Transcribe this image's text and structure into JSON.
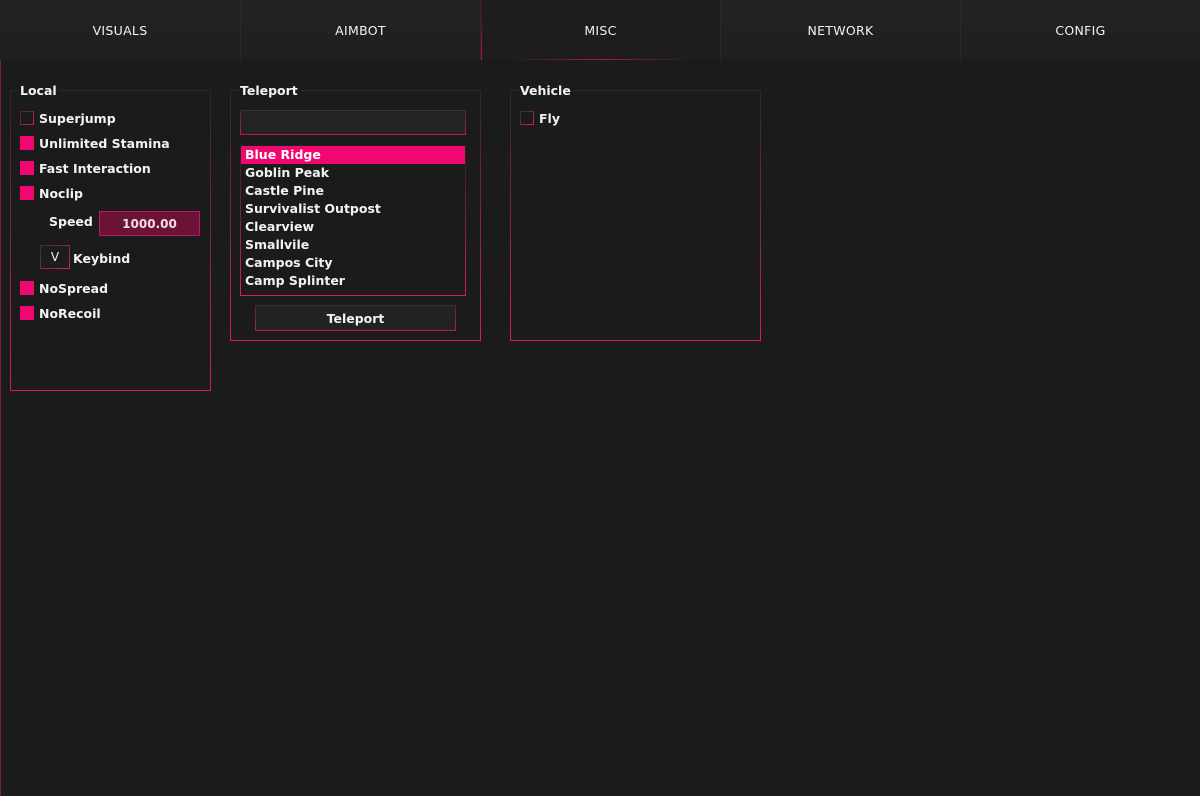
{
  "tabs": [
    {
      "label": "VISUALS",
      "active": false
    },
    {
      "label": "AIMBOT",
      "active": false
    },
    {
      "label": "MISC",
      "active": true
    },
    {
      "label": "NETWORK",
      "active": false
    },
    {
      "label": "CONFIG",
      "active": false
    }
  ],
  "local": {
    "title": "Local",
    "superjump": {
      "label": "Superjump",
      "checked": false
    },
    "unlimited_stamina": {
      "label": "Unlimited Stamina",
      "checked": true
    },
    "fast_interaction": {
      "label": "Fast Interaction",
      "checked": true
    },
    "noclip": {
      "label": "Noclip",
      "checked": true
    },
    "speed": {
      "label": "Speed",
      "value": "1000.00"
    },
    "keybind": {
      "key": "V",
      "label": "Keybind"
    },
    "nospread": {
      "label": "NoSpread",
      "checked": true
    },
    "norecoil": {
      "label": "NoRecoil",
      "checked": true
    }
  },
  "teleport": {
    "title": "Teleport",
    "search_value": "",
    "locations": [
      "Blue Ridge",
      "Goblin Peak",
      "Castle Pine",
      "Survivalist Outpost",
      "Clearview",
      "Smallvile",
      "Campos City",
      "Camp Splinter"
    ],
    "selected_index": 0,
    "button_label": "Teleport"
  },
  "vehicle": {
    "title": "Vehicle",
    "fly": {
      "label": "Fly",
      "checked": false
    }
  },
  "colors": {
    "accent": "#f0076f",
    "background": "#1b1b1b",
    "tab_bar": "#202020"
  }
}
